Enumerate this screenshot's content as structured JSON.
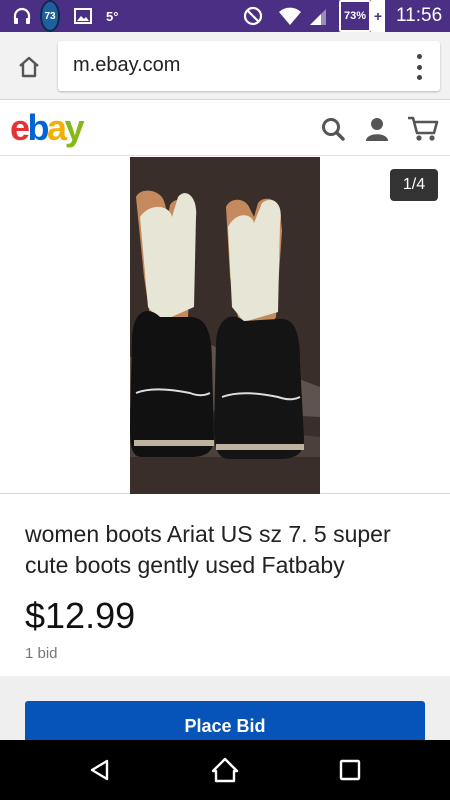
{
  "status_bar": {
    "notification_badge": "73",
    "temperature": "5°",
    "battery_percent": "73%",
    "time": "11:56",
    "icons": [
      "headphones-icon",
      "image-icon",
      "do-not-disturb-icon",
      "wifi-icon",
      "signal-icon",
      "battery-icon"
    ]
  },
  "browser": {
    "url": "m.ebay.com",
    "home_icon": "home-icon",
    "menu_icon": "more-vert-icon"
  },
  "header": {
    "logo": "ebay",
    "icons": [
      "search-icon",
      "account-icon",
      "cart-icon"
    ]
  },
  "gallery": {
    "pager": "1/4",
    "image_description_icon": "boots-photo"
  },
  "item": {
    "title": "women boots Ariat US sz 7. 5 super cute boots gently used Fatbaby",
    "price": "$12.99",
    "bids": "1 bid"
  },
  "actions": {
    "place_bid_label": "Place Bid"
  },
  "nav": {
    "icons": [
      "back-icon",
      "home-icon",
      "recents-icon"
    ]
  },
  "colors": {
    "status_bar": "#4a2f84",
    "place_bid": "#0654ba",
    "logo_e": "#e53238",
    "logo_b": "#0064d2",
    "logo_a": "#f5af02",
    "logo_y": "#86b817"
  }
}
